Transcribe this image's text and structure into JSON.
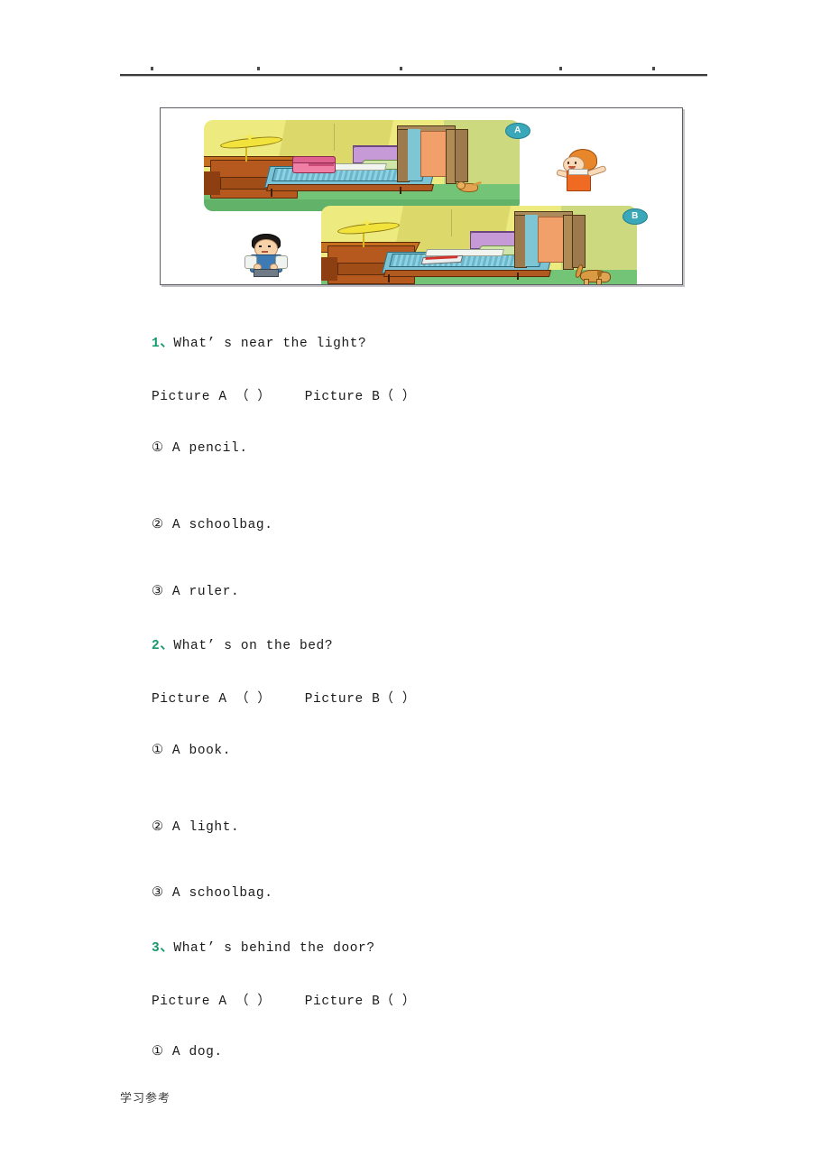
{
  "header": {
    "rule_dots": [
      34,
      152,
      310,
      487,
      590
    ]
  },
  "figure": {
    "caption_alt": "Two bedroom pictures labelled A and B with cartoon children",
    "panels": [
      {
        "id": "A",
        "badge_label": "A"
      },
      {
        "id": "B",
        "badge_label": "B"
      }
    ],
    "characters": [
      {
        "name": "girl",
        "panel": "A"
      },
      {
        "name": "boy",
        "panel": "B"
      }
    ]
  },
  "questions": [
    {
      "number": "1",
      "separator": "、",
      "text": "What’ s near the light?",
      "pick_line": "Picture A （ ）    Picture B（ ）",
      "options": [
        {
          "marker": "①",
          "text": "A pencil."
        },
        {
          "marker": "②",
          "text": "A schoolbag."
        },
        {
          "marker": "③",
          "text": "A ruler."
        }
      ]
    },
    {
      "number": "2",
      "separator": "、",
      "text": "What’ s on the bed?",
      "pick_line": "Picture A （ ）    Picture B（ ）",
      "options": [
        {
          "marker": "①",
          "text": "A book."
        },
        {
          "marker": "②",
          "text": "A light."
        },
        {
          "marker": "③",
          "text": "A schoolbag."
        }
      ]
    },
    {
      "number": "3",
      "separator": "、",
      "text": "What’ s behind the door?",
      "pick_line": "Picture A （ ）    Picture B（ ）",
      "options": [
        {
          "marker": "①",
          "text": "A dog."
        }
      ]
    }
  ],
  "footer": {
    "text": "学习参考"
  },
  "colors": {
    "accent_green": "#169a6b",
    "badge_teal": "#3aa8b8",
    "wall": "#edea80",
    "floor": "#74c478",
    "rule": "#3b3b3b"
  }
}
